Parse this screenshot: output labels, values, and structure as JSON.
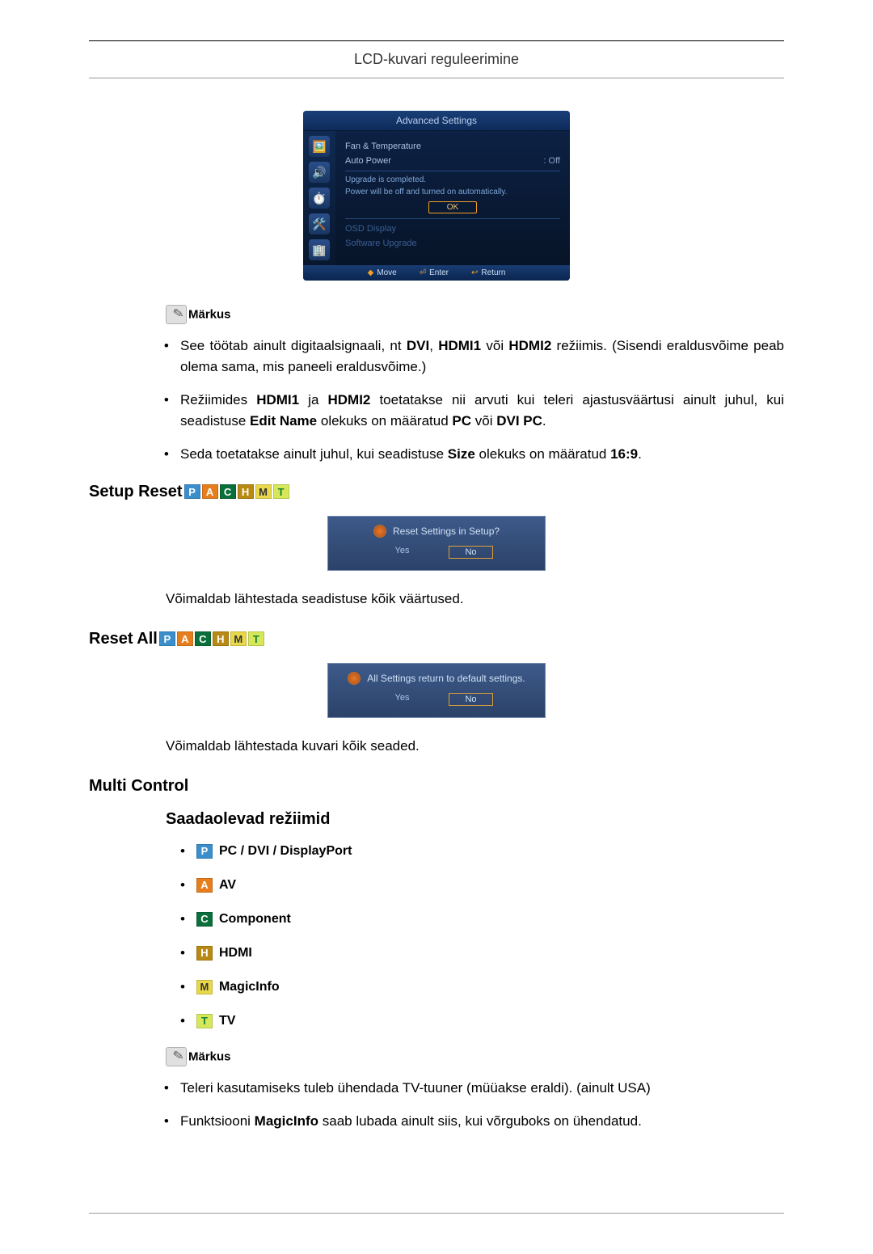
{
  "header": {
    "title": "LCD-kuvari reguleerimine"
  },
  "osd": {
    "title": "Advanced Settings",
    "rows": {
      "fan_temp": "Fan & Temperature",
      "auto_power_label": "Auto Power",
      "auto_power_value": ": Off"
    },
    "upgrade_done": "Upgrade is completed.",
    "power_off_on": "Power will be off and turned on automatically.",
    "ok": "OK",
    "osd_display": "OSD Display",
    "software_upgrade": "Software Upgrade",
    "footer": {
      "move": "Move",
      "enter": "Enter",
      "return": "Return"
    }
  },
  "note1": {
    "label": "Märkus",
    "b1_a": "See töötab ainult digitaalsignaali, nt ",
    "b1_b": "DVI",
    "b1_c": ", ",
    "b1_d": "HDMI1",
    "b1_e": " või ",
    "b1_f": "HDMI2",
    "b1_g": " režiimis. (Sisendi eraldusvõime peab olema sama, mis paneeli eraldusvõime.)",
    "b2_a": "Režiimides ",
    "b2_b": "HDMI1",
    "b2_c": " ja ",
    "b2_d": "HDMI2",
    "b2_e": " toetatakse nii arvuti kui teleri ajastusväärtusi ainult juhul, kui seadistuse ",
    "b2_f": "Edit Name",
    "b2_g": " olekuks on määratud ",
    "b2_h": "PC",
    "b2_i": " või ",
    "b2_j": "DVI PC",
    "b2_k": ".",
    "b3_a": "Seda toetatakse ainult juhul, kui seadistuse ",
    "b3_b": "Size",
    "b3_c": " olekuks on määratud ",
    "b3_d": "16:9",
    "b3_e": "."
  },
  "setup_reset": {
    "heading": "Setup Reset",
    "dialog_q": "Reset Settings in Setup?",
    "yes": "Yes",
    "no": "No",
    "desc": "Võimaldab lähtestada seadistuse kõik väärtused."
  },
  "reset_all": {
    "heading": "Reset All",
    "dialog_q": "All Settings return to default settings.",
    "yes": "Yes",
    "no": "No",
    "desc": "Võimaldab lähtestada kuvari kõik seaded."
  },
  "multi_control": {
    "heading": "Multi Control",
    "subheading": "Saadaolevad režiimid",
    "modes": {
      "p": "PC / DVI / DisplayPort",
      "a": "AV",
      "c": "Component",
      "h": "HDMI",
      "m": "MagicInfo",
      "t": "TV"
    }
  },
  "note2": {
    "label": "Märkus",
    "b1": "Teleri kasutamiseks tuleb ühendada TV-tuuner (müüakse eraldi). (ainult USA)",
    "b2_a": "Funktsiooni ",
    "b2_b": "MagicInfo",
    "b2_c": " saab lubada ainult siis, kui võrguboks on ühendatud."
  },
  "badges": {
    "P": "P",
    "A": "A",
    "C": "C",
    "H": "H",
    "M": "M",
    "T": "T"
  }
}
